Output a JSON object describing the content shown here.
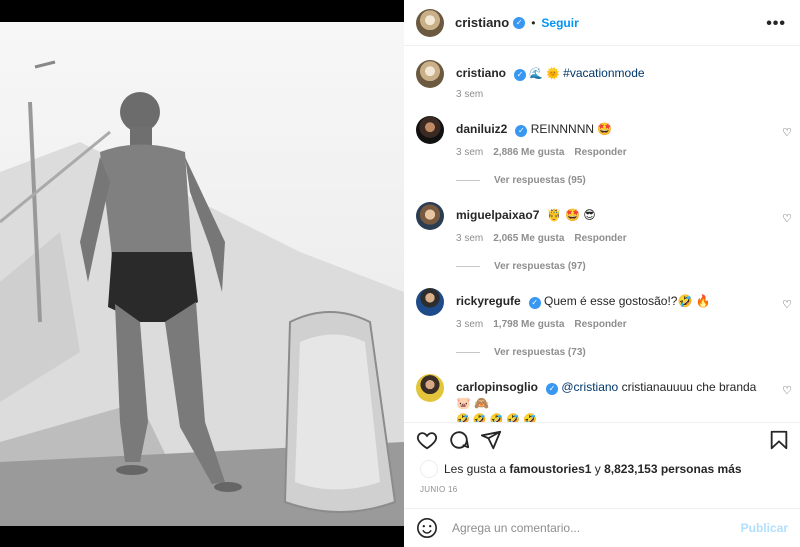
{
  "post": {
    "author": "cristiano",
    "follow_label": "Seguir",
    "more_label": "•••",
    "caption_emoji": "🌊 🌞",
    "caption_hashtag": "#vacationmode",
    "caption_time": "3 sem"
  },
  "comments": [
    {
      "user": "daniluiz2",
      "text": "REINNNNN 🤩",
      "time": "3 sem",
      "likes": "2,886 Me gusta",
      "reply": "Responder",
      "view_replies": "Ver respuestas (95)"
    },
    {
      "user": "miguelpaixao7",
      "text": "🤴 🤩 😎",
      "time": "3 sem",
      "likes": "2,065 Me gusta",
      "reply": "Responder",
      "view_replies": "Ver respuestas (97)"
    },
    {
      "user": "rickyregufe",
      "text": "Quem é esse gostosão!?🤣 🔥",
      "time": "3 sem",
      "likes": "1,798 Me gusta",
      "reply": "Responder",
      "view_replies": "Ver respuestas (73)"
    },
    {
      "user": "carlopinsoglio",
      "mention": "@cristiano",
      "text": "cristianauuuu che branda 🐷 🙈",
      "text2": "🤣 🤣 🤣 🤣 🤣"
    }
  ],
  "likes": {
    "prefix": "Les gusta a",
    "user": "famoustories1",
    "middle": "y",
    "count": "8,823,153 personas más"
  },
  "date": "JUNIO 16",
  "composer": {
    "placeholder": "Agrega un comentario...",
    "publish_label": "Publicar"
  },
  "icons": [
    "heart-icon",
    "comment-icon",
    "share-icon",
    "bookmark-icon",
    "emoji-icon",
    "verified-icon",
    "more-icon"
  ]
}
